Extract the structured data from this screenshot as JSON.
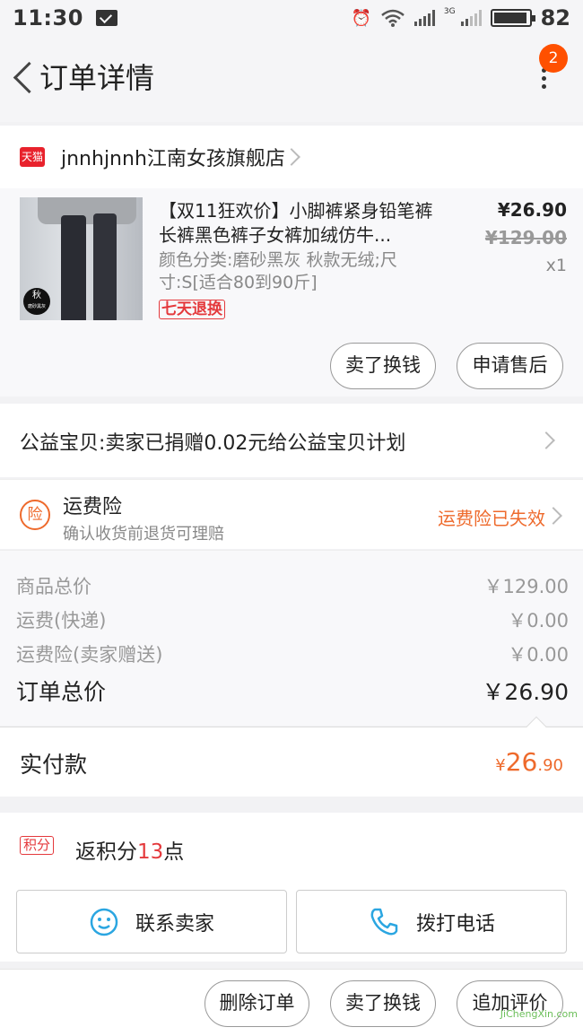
{
  "status_bar": {
    "time": "11:30",
    "network_label": "3G",
    "battery_level": "82"
  },
  "header": {
    "title": "订单详情",
    "notification_count": "2"
  },
  "shop": {
    "badge": "天猫",
    "name": "jnnhjnnh江南女孩旗舰店"
  },
  "product": {
    "title": "【双11狂欢价】小脚裤紧身铅笔裤长裤黑色裤子女裤加绒仿牛...",
    "attributes": "颜色分类:磨砂黑灰 秋款无绒;尺寸:S[适合80到90斤]",
    "return_tag": "七天退换",
    "price": "¥26.90",
    "original_price": "¥129.00",
    "quantity": "x1",
    "image_stamp": "秋",
    "image_stamp_sub": "磨砂黑灰",
    "sell_button": "卖了换钱",
    "after_sale_button": "申请售后"
  },
  "charity": {
    "text": "公益宝贝:卖家已捐赠0.02元给公益宝贝计划"
  },
  "insurance": {
    "icon_char": "险",
    "title": "运费险",
    "subtitle": "确认收货前退货可理赔",
    "status": "运费险已失效"
  },
  "totals": {
    "rows": [
      {
        "label": "商品总价",
        "value": "￥129.00"
      },
      {
        "label": "运费(快递)",
        "value": "￥0.00"
      },
      {
        "label": "运费险(卖家赠送)",
        "value": "￥0.00"
      }
    ],
    "order_total_label": "订单总价",
    "order_total_value": "￥26.90"
  },
  "payment": {
    "label": "实付款",
    "currency": "¥",
    "amount_int": "26",
    "amount_dec": ".90"
  },
  "points": {
    "tag": "积分",
    "prefix": "返积分",
    "count": "13",
    "suffix": "点"
  },
  "contact": {
    "seller_button": "联系卖家",
    "phone_button": "拨打电话"
  },
  "actions": {
    "delete_button": "删除订单",
    "sell_button": "卖了换钱",
    "review_button": "追加评价"
  },
  "watermark": "JiChengXin.com",
  "colors": {
    "accent": "#ee6a2c",
    "red": "#e4393c",
    "tmall": "#e8222c",
    "badge": "#ff5000",
    "link_blue": "#2ba6e1"
  }
}
